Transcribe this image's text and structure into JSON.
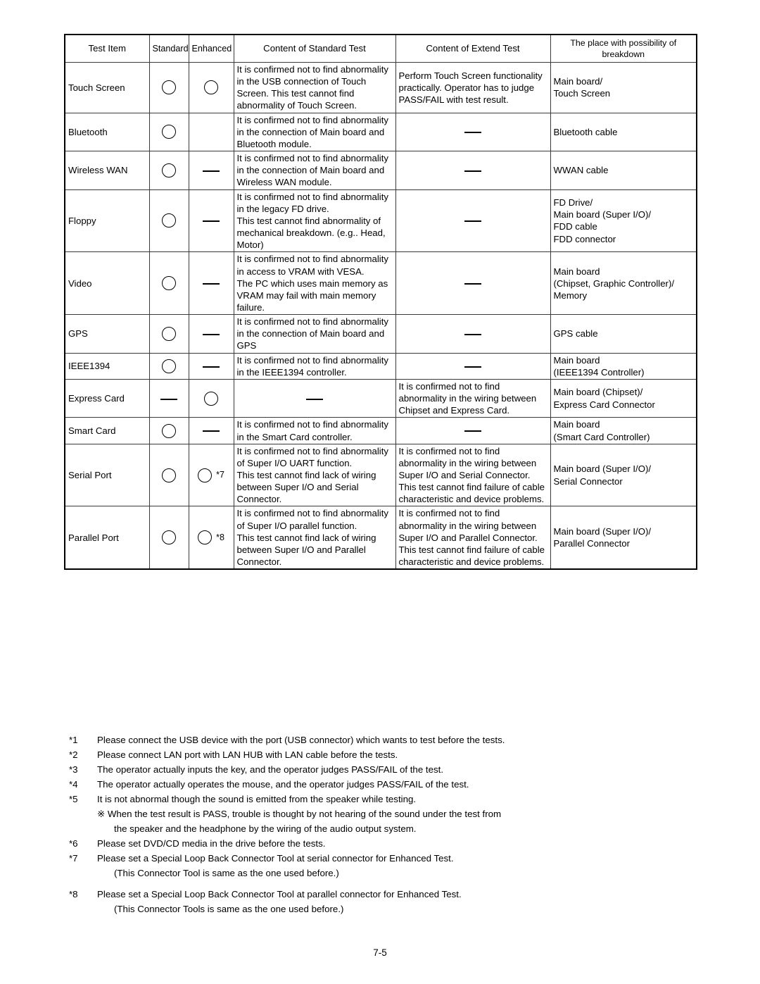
{
  "table": {
    "columns": [
      "Test Item",
      "Standard",
      "Enhanced",
      "Content of Standard Test",
      "Content of Extend Test",
      "The place with possibility of breakdown"
    ],
    "rows": [
      {
        "item": "Touch Screen",
        "standard": "circle",
        "enhanced": "circle",
        "enhanced_note": "",
        "standard_test": "It is confirmed not to find abnormality in the USB connection of Touch Screen. This test cannot find abnormality of Touch Screen.",
        "extend_test": "Perform Touch Screen functionality practically. Operator has to judge PASS/FAIL with test result.",
        "extend_test_mark": "",
        "place": "Main board/\nTouch Screen"
      },
      {
        "item": "Bluetooth",
        "standard": "circle",
        "enhanced": "none",
        "enhanced_note": "",
        "standard_test": "It is confirmed not to find abnormality in the connection of Main board and Bluetooth module.",
        "extend_test": "",
        "extend_test_mark": "dash",
        "place": "Bluetooth cable"
      },
      {
        "item": "Wireless WAN",
        "standard": "circle",
        "enhanced": "dash",
        "enhanced_note": "",
        "standard_test": "It is confirmed not to find abnormality in the connection of Main board and Wireless WAN module.",
        "extend_test": "",
        "extend_test_mark": "dash",
        "place": "WWAN cable"
      },
      {
        "item": "Floppy",
        "standard": "circle",
        "enhanced": "dash",
        "enhanced_note": "",
        "standard_test": "It is confirmed not to find abnormality in the legacy FD drive.\nThis test cannot find abnormality of mechanical breakdown. (e.g.. Head, Motor)",
        "extend_test": "",
        "extend_test_mark": "dash",
        "place": "FD Drive/\nMain board (Super I/O)/\nFDD cable\nFDD connector"
      },
      {
        "item": "Video",
        "standard": "circle",
        "enhanced": "dash",
        "enhanced_note": "",
        "standard_test": "It is confirmed not to find abnormality in access to VRAM with VESA.\nThe PC which uses main memory as VRAM may fail with main memory failure.",
        "extend_test": "",
        "extend_test_mark": "dash",
        "place": "Main board\n(Chipset, Graphic Controller)/\nMemory"
      },
      {
        "item": "GPS",
        "standard": "circle",
        "enhanced": "dash",
        "enhanced_note": "",
        "standard_test": "It is confirmed not to find abnormality in the connection of Main board and GPS",
        "extend_test": "",
        "extend_test_mark": "dash",
        "place": "GPS cable"
      },
      {
        "item": "IEEE1394",
        "standard": "circle",
        "enhanced": "dash",
        "enhanced_note": "",
        "standard_test": "It is confirmed not to find abnormality in the IEEE1394 controller.",
        "extend_test": "",
        "extend_test_mark": "dash",
        "place": "Main board\n(IEEE1394 Controller)"
      },
      {
        "item": "Express Card",
        "standard": "dash",
        "enhanced": "circle",
        "enhanced_note": "",
        "standard_test": "",
        "standard_test_mark": "dash",
        "extend_test": "It is confirmed not to find abnormality in the wiring between Chipset and Express Card.",
        "extend_test_mark": "",
        "place": "Main board (Chipset)/\nExpress Card Connector"
      },
      {
        "item": "Smart Card",
        "standard": "circle",
        "enhanced": "dash",
        "enhanced_note": "",
        "standard_test": "It is confirmed not to find abnormality in the Smart Card controller.",
        "extend_test": "",
        "extend_test_mark": "dash",
        "place": "Main board\n(Smart Card Controller)"
      },
      {
        "item": "Serial Port",
        "standard": "circle",
        "enhanced": "circle",
        "enhanced_note": "*7",
        "standard_test": "It is confirmed not to find abnormality of Super I/O UART function.\nThis test cannot find lack of wiring between Super I/O and Serial Connector.",
        "extend_test": "It is confirmed not to find abnormality in the wiring between Super I/O and Serial Connector.\nThis test cannot find failure of cable characteristic and device problems.",
        "extend_test_mark": "",
        "place": "Main board (Super I/O)/\nSerial Connector"
      },
      {
        "item": "Parallel Port",
        "standard": "circle",
        "enhanced": "circle",
        "enhanced_note": "*8",
        "standard_test": "It is confirmed not to find abnormality of Super I/O parallel function.\nThis test cannot find lack of wiring between Super I/O and Parallel Connector.",
        "extend_test": "It is confirmed not to find abnormality in the wiring between Super I/O and Parallel Connector.\nThis test cannot find failure of cable characteristic and device problems.",
        "extend_test_mark": "",
        "place": "Main board (Super I/O)/\nParallel Connector"
      }
    ]
  },
  "footnotes": [
    {
      "tag": "*1",
      "text": "Please connect the USB device with the port (USB connector) which wants to test before the tests."
    },
    {
      "tag": "*2",
      "text": "Please connect LAN port with LAN HUB with LAN cable before the tests."
    },
    {
      "tag": "*3",
      "text": "The operator actually inputs the key, and the operator judges PASS/FAIL of the test."
    },
    {
      "tag": "*4",
      "text": "The operator actually operates the mouse, and the operator judges PASS/FAIL of the test."
    },
    {
      "tag": "*5",
      "text": "It is not abnormal though the sound is emitted from the speaker while testing."
    },
    {
      "tag": "",
      "text": "※ When the test result is PASS, trouble is thought by not hearing of the sound under the test from"
    },
    {
      "tag": "",
      "text": "the speaker and the headphone by the wiring of the audio output system."
    },
    {
      "tag": "*6",
      "text": "Please set DVD/CD media in the drive before the tests."
    },
    {
      "tag": "*7",
      "text": "Please set a Special Loop Back Connector Tool at serial connector for Enhanced Test."
    },
    {
      "tag": "",
      "text": "(This Connector Tool is same as the one used before.)"
    },
    {
      "tag": "*8",
      "text": "Please set a Special Loop Back Connector Tool at parallel connector for Enhanced Test."
    },
    {
      "tag": "",
      "text": "(This Connector Tools is same as the one used before.)"
    }
  ],
  "page_number": "7-5"
}
